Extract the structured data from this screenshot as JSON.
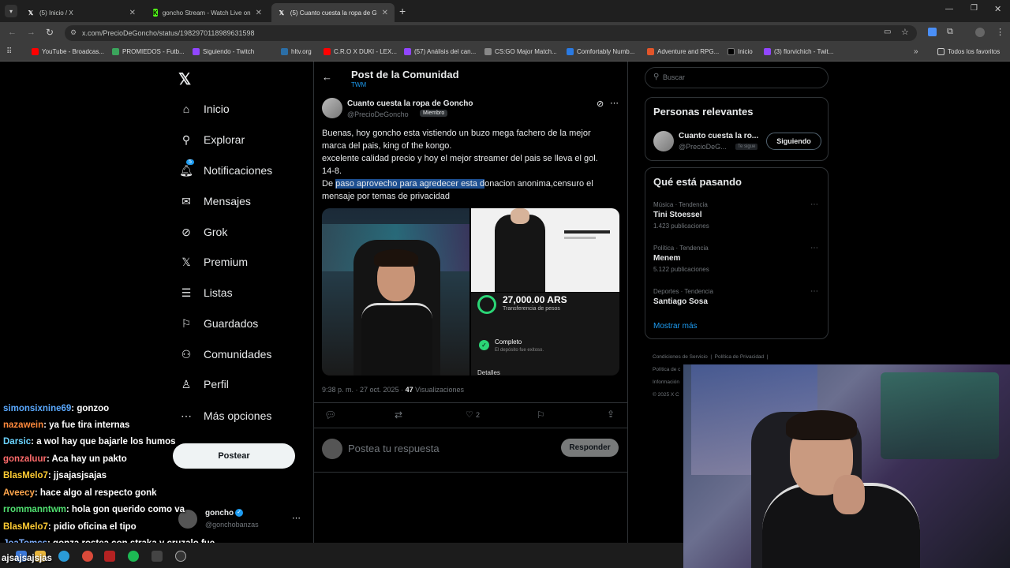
{
  "tabs": [
    {
      "label": "(5) Inicio / X"
    },
    {
      "label": "goncho Stream - Watch Live on"
    },
    {
      "label": "(5) Cuanto cuesta la ropa de Go"
    }
  ],
  "url": "x.com/PrecioDeGoncho/status/1982970118989631598",
  "bookmarks": [
    {
      "label": "YouTube - Broadcas..."
    },
    {
      "label": "PROMIEDOS - Futb..."
    },
    {
      "label": "Siguiendo - Twitch"
    },
    {
      "label": "hltv.org"
    },
    {
      "label": "C.R.O X DUKI - LEX..."
    },
    {
      "label": "(57) Análisis del can..."
    },
    {
      "label": "CS:GO Major Match..."
    },
    {
      "label": "Comfortably Numb..."
    },
    {
      "label": "Adventure and RPG..."
    },
    {
      "label": "Inicio"
    },
    {
      "label": "(3) florvichich - Twit..."
    },
    {
      "label": "Todos los favoritos"
    }
  ],
  "nav": {
    "items": [
      {
        "label": "Inicio"
      },
      {
        "label": "Explorar"
      },
      {
        "label": "Notificaciones",
        "badge": "5"
      },
      {
        "label": "Mensajes"
      },
      {
        "label": "Grok"
      },
      {
        "label": "Premium"
      },
      {
        "label": "Listas"
      },
      {
        "label": "Guardados"
      },
      {
        "label": "Comunidades"
      },
      {
        "label": "Perfil"
      },
      {
        "label": "Más opciones"
      }
    ],
    "post_button": "Postear",
    "account_name": "goncho",
    "account_handle": "@gonchobanzas"
  },
  "header": {
    "title": "Post de la Comunidad",
    "subtitle": "TWM"
  },
  "post": {
    "author": "Cuanto cuesta la ropa de Goncho",
    "handle": "@PrecioDeGoncho",
    "role": "Miembro",
    "lines": [
      "Buenas, hoy goncho esta vistiendo un buzo mega fachero de la mejor",
      "marca del pais, king of the kongo.",
      "excelente calidad precio y hoy el mejor streamer del pais se lleva el gol.",
      "14-8."
    ],
    "line5_pre": "De ",
    "line5_hl": "paso aprovecho para agredecer esta d",
    "line5_post": "onacion anonima,censuro el",
    "line6": "mensaje por temas de privacidad",
    "receipt_amount": "27,000.00 ARS",
    "receipt_type": "Transferencia de pesos",
    "receipt_status": "Completo",
    "receipt_status_sub": "El depósito fue exitoso.",
    "receipt_details": "Detalles",
    "time": "9:38 p. m.",
    "date": "27 oct. 2025",
    "views": "47",
    "views_label": "Visualizaciones",
    "likes": "2",
    "reply_placeholder": "Postea tu respuesta",
    "reply_button": "Responder"
  },
  "sidebar": {
    "search_placeholder": "Buscar",
    "relevant_title": "Personas relevantes",
    "relevant_name": "Cuanto cuesta la ro...",
    "relevant_handle": "@PrecioDeG...",
    "relevant_badge": "Te sigue",
    "follow_button": "Siguiendo",
    "trending_title": "Qué está pasando",
    "trends": [
      {
        "category": "Música · Tendencia",
        "name": "Tini Stoessel",
        "count": "1.423 publicaciones"
      },
      {
        "category": "Política · Tendencia",
        "name": "Menem",
        "count": "5.122 publicaciones"
      },
      {
        "category": "Deportes · Tendencia",
        "name": "Santiago Sosa",
        "count": ""
      }
    ],
    "show_more": "Mostrar más",
    "footer": [
      "Condiciones de Servicio",
      "Política de Privacidad",
      "|",
      "Política de c",
      "Información",
      "© 2025 X C"
    ]
  },
  "chat": [
    {
      "user": "simonsixnine69",
      "color": "#5aa9ff",
      "msg": ": gonzoo"
    },
    {
      "user": "nazawein",
      "color": "#ff8a3d",
      "msg": ": ya fue tira internas"
    },
    {
      "user": "Darsic",
      "color": "#6bd4ff",
      "msg": ": a wol hay que bajarle los humos"
    },
    {
      "user": "gonzaluur",
      "color": "#ff6b6b",
      "msg": ": Aca hay un pakto"
    },
    {
      "user": "BlasMelo7",
      "color": "#ffcc33",
      "msg": ": jjsajasjsajas"
    },
    {
      "user": "Aveecy",
      "color": "#ffa64d",
      "msg": ": hace algo al respecto gonk"
    },
    {
      "user": "rrommanntwm",
      "color": "#50e070",
      "msg": ": hola gon querido como va"
    },
    {
      "user": "BlasMelo7",
      "color": "#ffcc33",
      "msg": ": pidio oficina el tipo"
    },
    {
      "user": "JoaTomcs",
      "color": "#7fb0ff",
      "msg": ": gonza rostea con straka y cruzalo fue"
    },
    {
      "user": "",
      "color": "#ffffff",
      "msg": "ajsajsajsjas"
    }
  ],
  "colors": {
    "accent": "#1d9bf0",
    "highlight": "#1d4f91",
    "background": "#000000"
  }
}
